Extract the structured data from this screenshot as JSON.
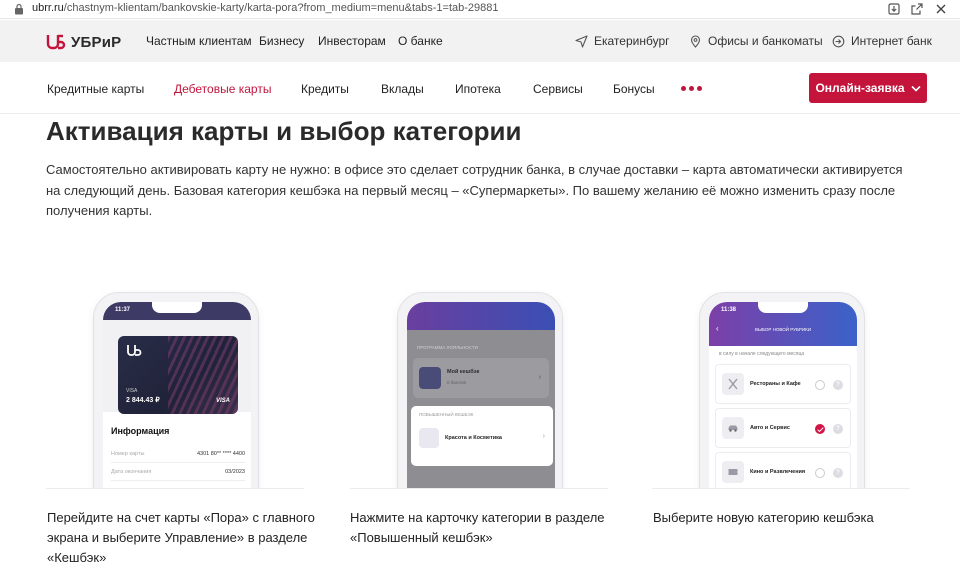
{
  "browser": {
    "url_host": "ubrr.ru",
    "url_path": "/chastnym-klientam/bankovskie-karty/karta-pora?from_medium=menu&tabs-1=tab-29881"
  },
  "topnav": {
    "logo_text": "УБРиР",
    "links": [
      "Частным клиентам",
      "Бизнесу",
      "Инвесторам",
      "О банке"
    ],
    "city": "Екатеринбург",
    "offices": "Офисы и банкоматы",
    "internet_bank": "Интернет банк"
  },
  "prodnav": {
    "items": [
      "Кредитные карты",
      "Дебетовые карты",
      "Кредиты",
      "Вклады",
      "Ипотека",
      "Сервисы",
      "Бонусы"
    ],
    "active_index": 1,
    "apply_label": "Онлайн-заявка"
  },
  "content": {
    "title": "Активация карты и выбор категории",
    "lead": "Самостоятельно активировать карту не нужно: в офисе это сделает сотрудник банка, в случае доставки – карта автоматически активируется на следующий день. Базовая категория кешбэка на первый месяц – «Супермаркеты». По вашему желанию её можно изменить сразу после получения карты."
  },
  "steps": [
    {
      "caption": "Перейдите на счет карты «Пора» с главного экрана и выберите Управление» в разделе «Кешбэк»",
      "phone": {
        "time": "11:37",
        "card_type": "VISA",
        "card_balance": "2 844.43 ₽",
        "card_brand": "VISA",
        "info_title": "Информация",
        "rows": [
          {
            "label": "Номер карты",
            "value": "4301 80** **** 4400"
          },
          {
            "label": "Дата окончания",
            "value": "03/2023"
          }
        ]
      }
    },
    {
      "caption": "Нажмите на карточку категории в разделе «Повышенный кешбэк»",
      "phone": {
        "section_label": "Программа лояльности",
        "card1_title": "Мой кешбэк",
        "card1_sub": "0 баллов",
        "section2_label": "Повышенный кешбэк",
        "card2_title": "Красота и Косметика"
      }
    },
    {
      "caption": "Выберите новую категорию кешбэка",
      "phone": {
        "time": "11:38",
        "header": "Выбор новой рубрики",
        "subtitle": "в силу в начале следующего месяца",
        "items": [
          {
            "title": "Рестораны и Кафе",
            "selected": false
          },
          {
            "title": "Авто и Сервис",
            "selected": true
          },
          {
            "title": "Кино и Развлечения",
            "selected": false
          }
        ]
      }
    }
  ],
  "colors": {
    "brand": "#c4143b",
    "nav_bg": "#f2f2f2"
  }
}
